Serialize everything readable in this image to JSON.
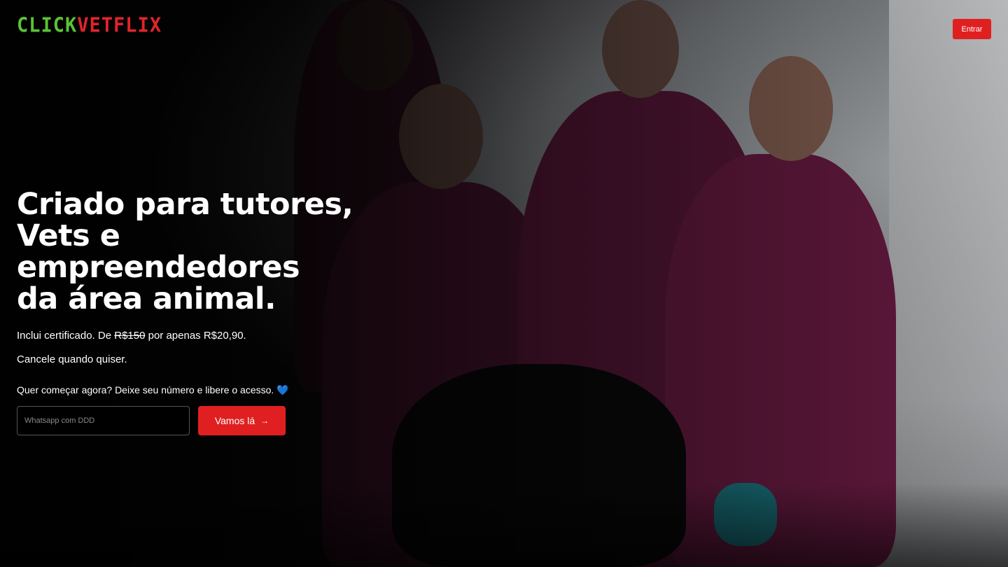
{
  "header": {
    "logo_part1": "CLICK",
    "logo_part2": "VETFLIX",
    "login_label": "Entrar"
  },
  "hero": {
    "headline_lines": [
      "Criado para tutores,",
      "Vets e",
      "empreendedores",
      "da área animal."
    ],
    "subtitle_prefix": "Inclui certificado. De ",
    "old_price": "R$150",
    "subtitle_suffix": " por apenas R$20,90.",
    "cancel_text": "Cancele quando quiser.",
    "cta_text": "Quer começar agora? Deixe seu número e libere o acesso.",
    "cta_emoji": "💙",
    "phone_placeholder": "Whatsapp com DDD",
    "submit_label": "Vamos lá",
    "submit_icon": "→"
  },
  "colors": {
    "brand_green": "#5bc236",
    "brand_red": "#e0242b",
    "button_red": "#e02020"
  }
}
